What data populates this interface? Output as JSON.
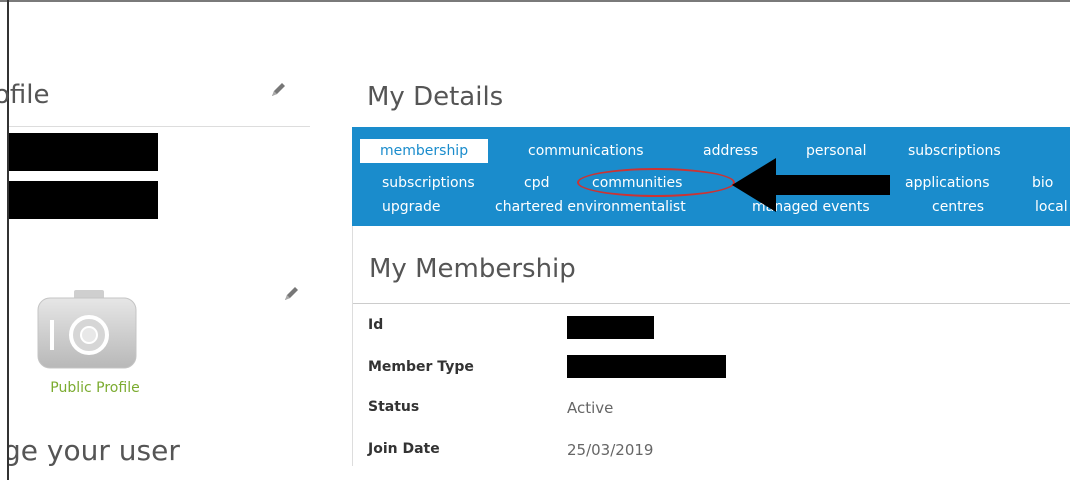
{
  "profile": {
    "heading": "ofile",
    "public_profile_label": "Public Profile",
    "manage_heading": "ge your user"
  },
  "details": {
    "title": "My Details",
    "tabs_row1": [
      "membership",
      "communications",
      "address",
      "personal",
      "subscriptions"
    ],
    "tabs_row2": [
      "subscriptions",
      "cpd",
      "communities",
      "applications",
      "bio"
    ],
    "tabs_row3": [
      "upgrade",
      "chartered environmentalist",
      "managed events",
      "centres",
      "local"
    ],
    "active_tab": "membership"
  },
  "membership": {
    "title": "My Membership",
    "fields": [
      {
        "label": "Id",
        "value": ""
      },
      {
        "label": "Member Type",
        "value": ""
      },
      {
        "label": "Status",
        "value": "Active"
      },
      {
        "label": "Join Date",
        "value": "25/03/2019"
      }
    ]
  },
  "colors": {
    "nav_bar": "#1a8ccc",
    "public_profile_text": "#7bab2f",
    "highlight": "#cc3333"
  },
  "icons": [
    "pencil-icon",
    "camera-icon",
    "arrow-left-icon"
  ]
}
